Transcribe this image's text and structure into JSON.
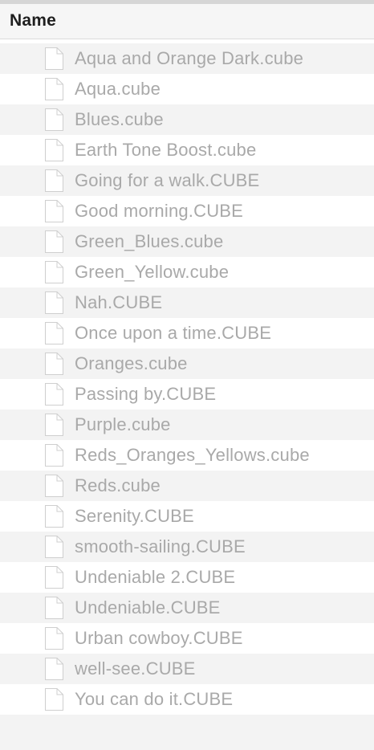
{
  "header": {
    "column_name": "Name"
  },
  "files": [
    "Aqua and Orange Dark.cube",
    "Aqua.cube",
    "Blues.cube",
    "Earth Tone Boost.cube",
    "Going for a walk.CUBE",
    "Good morning.CUBE",
    "Green_Blues.cube",
    "Green_Yellow.cube",
    "Nah.CUBE",
    "Once upon a time.CUBE",
    "Oranges.cube",
    "Passing by.CUBE",
    "Purple.cube",
    "Reds_Oranges_Yellows.cube",
    "Reds.cube",
    "Serenity.CUBE",
    "smooth-sailing.CUBE",
    "Undeniable 2.CUBE",
    "Undeniable.CUBE",
    "Urban cowboy.CUBE",
    "well-see.CUBE",
    "You can do it.CUBE"
  ],
  "icons": {
    "file": "document-icon"
  },
  "colors": {
    "text_dimmed": "#a9a9a9",
    "row_alt": "#f3f3f3",
    "header_bg": "#f6f6f6"
  }
}
